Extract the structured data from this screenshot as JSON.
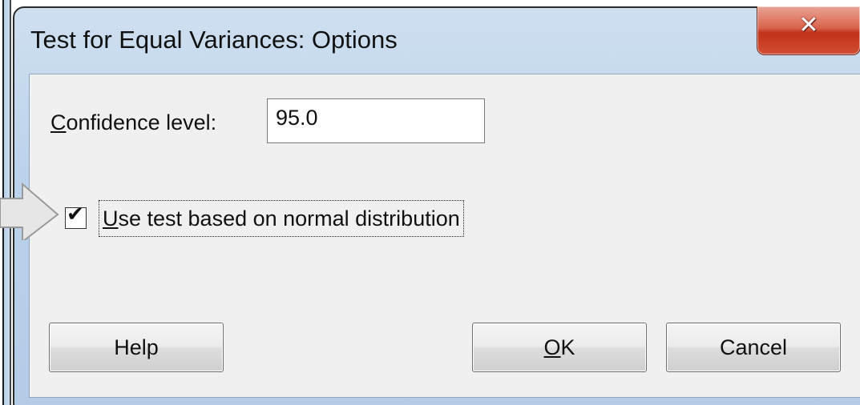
{
  "window": {
    "title": "Test for Equal Variances: Options",
    "close_icon": "close-icon"
  },
  "form": {
    "confidence_label_prefix": "",
    "confidence_label_mnemonic": "C",
    "confidence_label_rest": "onfidence level:",
    "confidence_value": "95.0",
    "checkbox_checked": true,
    "checkbox_label_mnemonic": "U",
    "checkbox_label_rest": "se test based on normal distribution"
  },
  "buttons": {
    "help": "Help",
    "ok_mnemonic": "O",
    "ok_rest": "K",
    "cancel": "Cancel"
  },
  "colors": {
    "close_button": "#c1321a",
    "client_background": "#f0f0f0",
    "title_bar": "#bcd3ec",
    "arrow_fill": "#e6e6e6"
  }
}
